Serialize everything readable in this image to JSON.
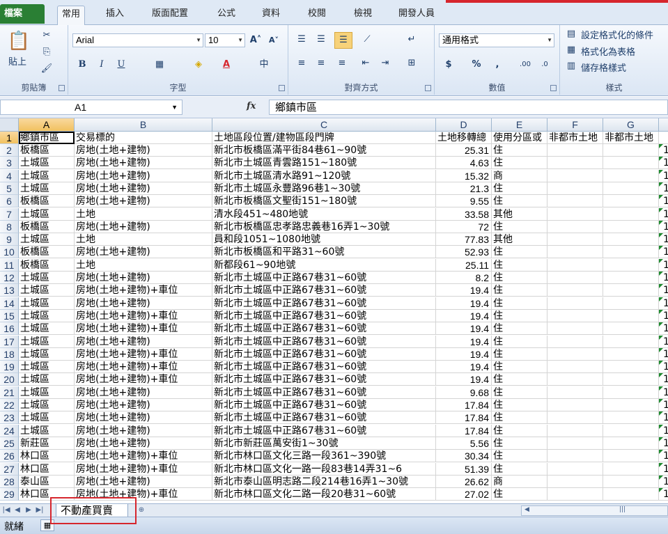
{
  "ribbon_tabs": {
    "file": "檔案",
    "home": "常用",
    "insert": "插入",
    "page_layout": "版面配置",
    "formulas": "公式",
    "data": "資料",
    "review": "校閱",
    "view": "檢視",
    "developer": "開發人員"
  },
  "clipboard": {
    "paste_label": "貼上",
    "group_label": "剪貼簿"
  },
  "font": {
    "name": "Arial",
    "size": "10",
    "bold": "B",
    "italic": "I",
    "underline": "U",
    "group_label": "字型"
  },
  "alignment": {
    "group_label": "對齊方式"
  },
  "number": {
    "format": "通用格式",
    "currency": "$",
    "percent": "%",
    "comma": ",",
    "group_label": "數值"
  },
  "styles": {
    "conditional": "設定格式化的條件",
    "as_table": "格式化為表格",
    "cell_styles": "儲存格樣式",
    "group_label": "樣式"
  },
  "formula_bar": {
    "name_box": "A1",
    "fx": "fx",
    "content": "鄉鎮市區"
  },
  "columns": {
    "A": "A",
    "B": "B",
    "C": "C",
    "D": "D",
    "E": "E",
    "F": "F",
    "G": "G"
  },
  "header_row": {
    "A": "鄉鎮市區",
    "B": "交易標的",
    "C": "土地區段位置/建物區段門牌",
    "D": "土地移轉總",
    "E": "使用分區或",
    "F": "非都市土地",
    "G": "非都市土地"
  },
  "rows": [
    {
      "n": "2",
      "a": "板橋區",
      "b": "房地(土地+建物)",
      "c": "新北市板橋區滿平街84巷61~90號",
      "d": "25.31",
      "e": "住"
    },
    {
      "n": "3",
      "a": "土城區",
      "b": "房地(土地+建物)",
      "c": "新北市土城區青雲路151~180號",
      "d": "4.63",
      "e": "住"
    },
    {
      "n": "4",
      "a": "土城區",
      "b": "房地(土地+建物)",
      "c": "新北市土城區清水路91~120號",
      "d": "15.32",
      "e": "商"
    },
    {
      "n": "5",
      "a": "土城區",
      "b": "房地(土地+建物)",
      "c": "新北市土城區永豐路96巷1~30號",
      "d": "21.3",
      "e": "住"
    },
    {
      "n": "6",
      "a": "板橋區",
      "b": "房地(土地+建物)",
      "c": "新北市板橋區文聖街151~180號",
      "d": "9.55",
      "e": "住"
    },
    {
      "n": "7",
      "a": "土城區",
      "b": "土地",
      "c": "清水段451~480地號",
      "d": "33.58",
      "e": "其他"
    },
    {
      "n": "8",
      "a": "板橋區",
      "b": "房地(土地+建物)",
      "c": "新北市板橋區忠孝路忠義巷16弄1~30號",
      "d": "72",
      "e": "住"
    },
    {
      "n": "9",
      "a": "土城區",
      "b": "土地",
      "c": "員和段1051~1080地號",
      "d": "77.83",
      "e": "其他"
    },
    {
      "n": "10",
      "a": "板橋區",
      "b": "房地(土地+建物)",
      "c": "新北市板橋區和平路31~60號",
      "d": "52.93",
      "e": "住"
    },
    {
      "n": "11",
      "a": "板橋區",
      "b": "土地",
      "c": "新都段61~90地號",
      "d": "25.11",
      "e": "住"
    },
    {
      "n": "12",
      "a": "土城區",
      "b": "房地(土地+建物)",
      "c": "新北市土城區中正路67巷31~60號",
      "d": "8.2",
      "e": "住"
    },
    {
      "n": "13",
      "a": "土城區",
      "b": "房地(土地+建物)+車位",
      "c": "新北市土城區中正路67巷31~60號",
      "d": "19.4",
      "e": "住"
    },
    {
      "n": "14",
      "a": "土城區",
      "b": "房地(土地+建物)",
      "c": "新北市土城區中正路67巷31~60號",
      "d": "19.4",
      "e": "住"
    },
    {
      "n": "15",
      "a": "土城區",
      "b": "房地(土地+建物)+車位",
      "c": "新北市土城區中正路67巷31~60號",
      "d": "19.4",
      "e": "住"
    },
    {
      "n": "16",
      "a": "土城區",
      "b": "房地(土地+建物)+車位",
      "c": "新北市土城區中正路67巷31~60號",
      "d": "19.4",
      "e": "住"
    },
    {
      "n": "17",
      "a": "土城區",
      "b": "房地(土地+建物)",
      "c": "新北市土城區中正路67巷31~60號",
      "d": "19.4",
      "e": "住"
    },
    {
      "n": "18",
      "a": "土城區",
      "b": "房地(土地+建物)+車位",
      "c": "新北市土城區中正路67巷31~60號",
      "d": "19.4",
      "e": "住"
    },
    {
      "n": "19",
      "a": "土城區",
      "b": "房地(土地+建物)+車位",
      "c": "新北市土城區中正路67巷31~60號",
      "d": "19.4",
      "e": "住"
    },
    {
      "n": "20",
      "a": "土城區",
      "b": "房地(土地+建物)+車位",
      "c": "新北市土城區中正路67巷31~60號",
      "d": "19.4",
      "e": "住"
    },
    {
      "n": "21",
      "a": "土城區",
      "b": "房地(土地+建物)",
      "c": "新北市土城區中正路67巷31~60號",
      "d": "9.68",
      "e": "住"
    },
    {
      "n": "22",
      "a": "土城區",
      "b": "房地(土地+建物)",
      "c": "新北市土城區中正路67巷31~60號",
      "d": "17.84",
      "e": "住"
    },
    {
      "n": "23",
      "a": "土城區",
      "b": "房地(土地+建物)",
      "c": "新北市土城區中正路67巷31~60號",
      "d": "17.84",
      "e": "住"
    },
    {
      "n": "24",
      "a": "土城區",
      "b": "房地(土地+建物)",
      "c": "新北市土城區中正路67巷31~60號",
      "d": "17.84",
      "e": "住"
    },
    {
      "n": "25",
      "a": "新莊區",
      "b": "房地(土地+建物)",
      "c": "新北市新莊區萬安街1~30號",
      "d": "5.56",
      "e": "住"
    },
    {
      "n": "26",
      "a": "林口區",
      "b": "房地(土地+建物)+車位",
      "c": "新北市林口區文化三路一段361~390號",
      "d": "30.34",
      "e": "住"
    },
    {
      "n": "27",
      "a": "林口區",
      "b": "房地(土地+建物)+車位",
      "c": "新北市林口區文化一路一段83巷14弄31~6",
      "d": "51.39",
      "e": "住"
    },
    {
      "n": "28",
      "a": "泰山區",
      "b": "房地(土地+建物)",
      "c": "新北市泰山區明志路二段214巷16弄1~30號",
      "d": "26.62",
      "e": "商"
    },
    {
      "n": "29",
      "a": "林口區",
      "b": "房地(土地+建物)+車位",
      "c": "新北市林口區文化二路一段20巷31~60號",
      "d": "27.02",
      "e": "住"
    }
  ],
  "h_truncated": "1(",
  "sheet_tab": {
    "name": "不動產買賣"
  },
  "status": {
    "ready": "就緒"
  },
  "colors": {
    "accent_red": "#d6262d",
    "selected_header": "#f1c15f",
    "file_tab": "#2a7f34"
  }
}
